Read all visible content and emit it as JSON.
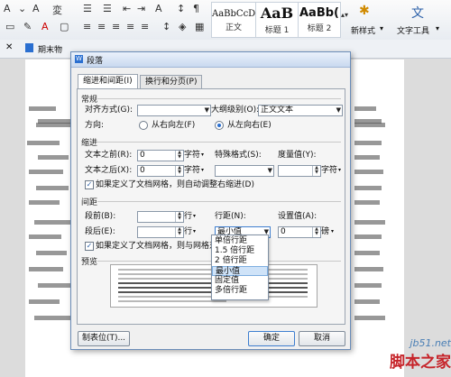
{
  "ribbon": {
    "styles": [
      {
        "sample": "AaBbCcD",
        "label": "正文"
      },
      {
        "sample": "AaB",
        "label": "标题 1"
      },
      {
        "sample": "AaBb(",
        "label": "标题 2"
      }
    ],
    "new_style_label": "新样式",
    "text_tools_label": "文字工具"
  },
  "doc_tab": {
    "name": "期末物"
  },
  "dialog": {
    "title": "段落",
    "tabs": [
      "缩进和间距(I)",
      "换行和分页(P)"
    ],
    "general": {
      "section": "常规",
      "align_label": "对齐方式(G):",
      "align_value": "",
      "outline_label": "大纲级别(O):",
      "outline_value": "正文文本",
      "direction_label": "方向:",
      "rtl_label": "从右向左(F)",
      "ltr_label": "从左向右(E)",
      "ltr_selected": true
    },
    "indent": {
      "section": "缩进",
      "before_label": "文本之前(R):",
      "before_value": "0",
      "after_label": "文本之后(X):",
      "after_value": "0",
      "unit": "字符",
      "special_label": "特殊格式(S):",
      "special_value": "",
      "measure_label": "度量值(Y):",
      "measure_value": "",
      "grid_check_label": "如果定义了文档网格，则自动调整右缩进(D)",
      "grid_checked": true
    },
    "spacing": {
      "section": "间距",
      "before_label": "段前(B):",
      "before_value": "",
      "after_label": "段后(E):",
      "after_value": "",
      "unit": "行",
      "line_label": "行距(N):",
      "line_value": "最小值",
      "setting_label": "设置值(A):",
      "setting_value": "0",
      "setting_unit": "磅",
      "grid_check_label": "如果定义了文档网格，则与网格对",
      "grid_checked": true
    },
    "preview_label": "预览",
    "tab_stops_button": "制表位(T)...",
    "ok_button": "确定",
    "cancel_button": "取消"
  },
  "line_spacing_options": [
    "单倍行距",
    "1.5 倍行距",
    "2 倍行距",
    "最小值",
    "固定值",
    "多倍行距"
  ],
  "line_spacing_selected_index": 3,
  "watermark": {
    "site": "jb51.net",
    "brand": "脚本之家"
  }
}
